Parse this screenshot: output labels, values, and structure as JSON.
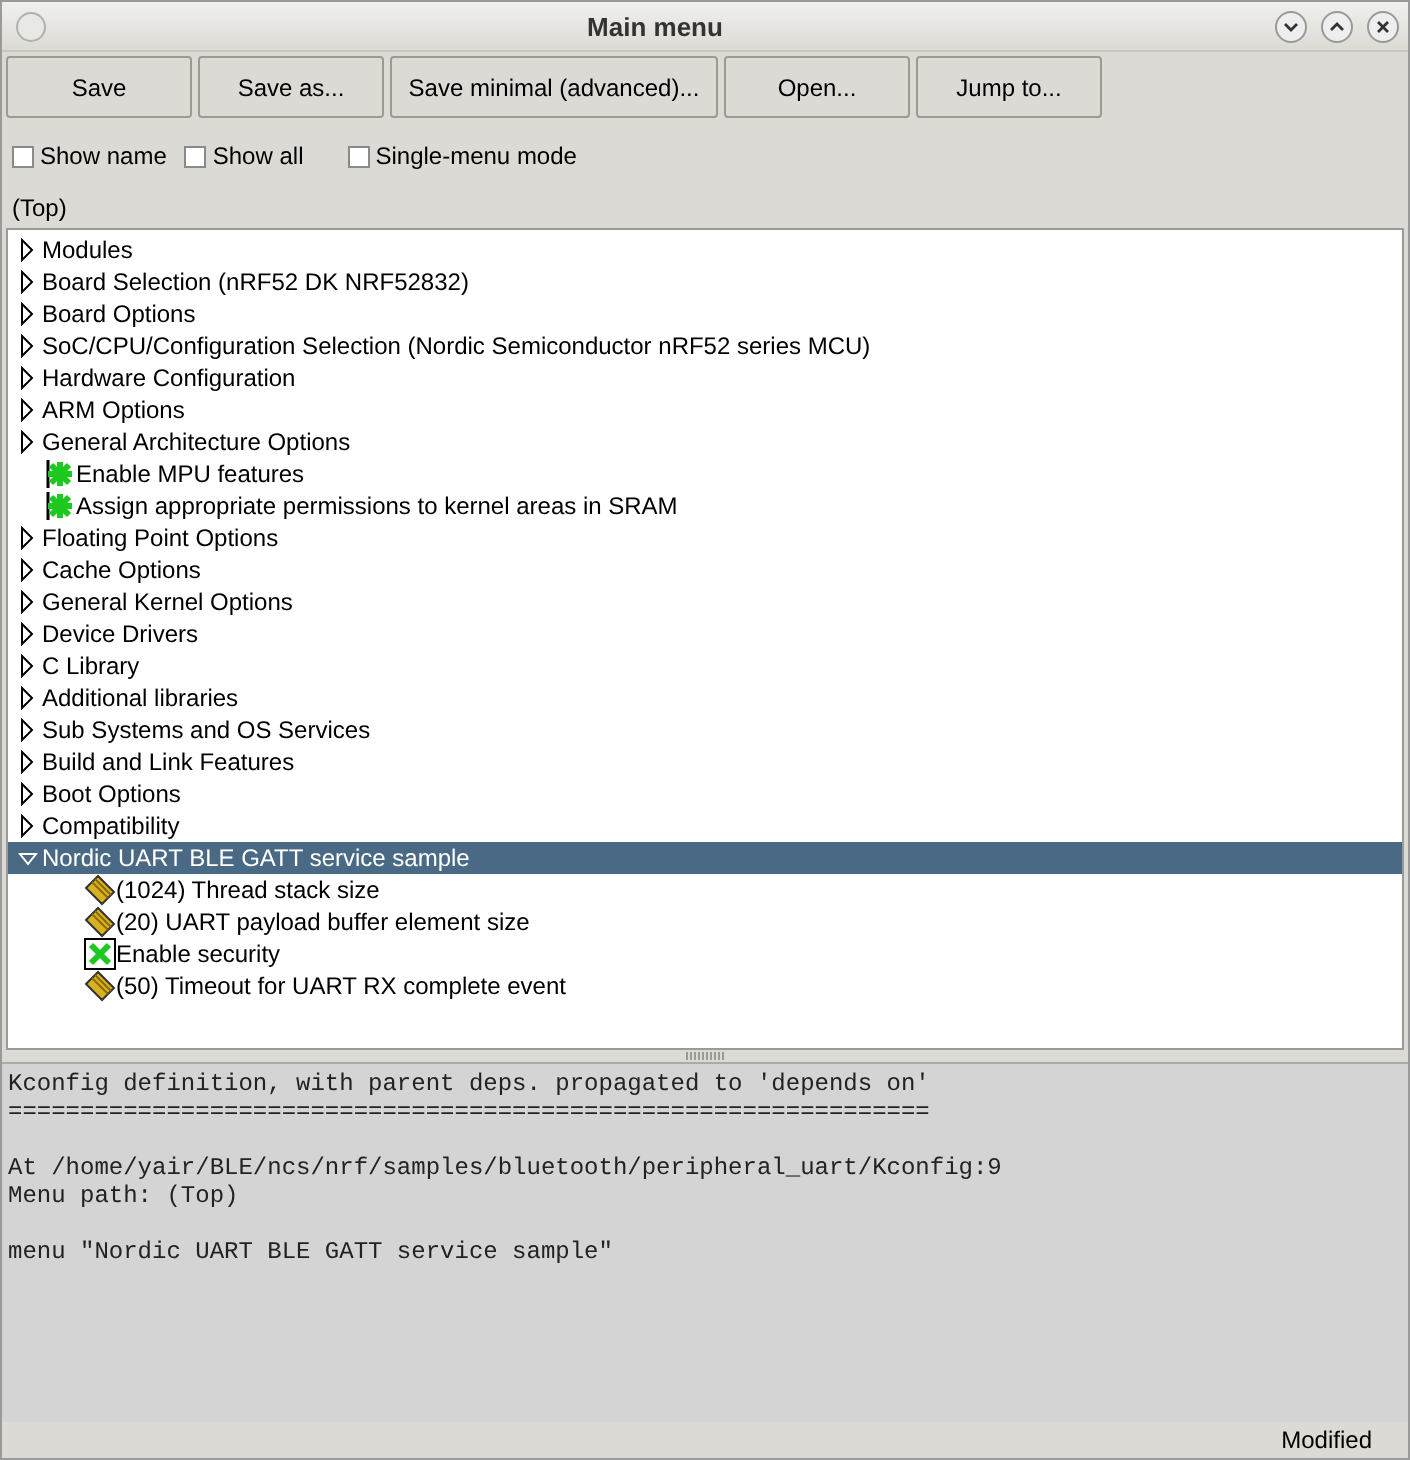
{
  "window": {
    "title": "Main menu"
  },
  "buttons": [
    "Save",
    "Save as...",
    "Save minimal (advanced)...",
    "Open...",
    "Jump to..."
  ],
  "options": [
    {
      "label": "Show name",
      "checked": false
    },
    {
      "label": "Show all",
      "checked": false
    },
    {
      "label": "Single-menu mode",
      "checked": false
    }
  ],
  "menu_path": "(Top)",
  "tree": [
    {
      "kind": "menu",
      "label": "Modules",
      "expanded": false,
      "selected": false
    },
    {
      "kind": "menu",
      "label": "Board Selection (nRF52 DK NRF52832)",
      "expanded": false,
      "selected": false
    },
    {
      "kind": "menu",
      "label": "Board Options",
      "expanded": false,
      "selected": false
    },
    {
      "kind": "menu",
      "label": "SoC/CPU/Configuration Selection (Nordic Semiconductor nRF52 series MCU)",
      "expanded": false,
      "selected": false
    },
    {
      "kind": "menu",
      "label": "Hardware Configuration",
      "expanded": false,
      "selected": false
    },
    {
      "kind": "menu",
      "label": "ARM Options",
      "expanded": false,
      "selected": false
    },
    {
      "kind": "menu",
      "label": "General Architecture Options",
      "expanded": false,
      "selected": false
    },
    {
      "kind": "star",
      "label": "Enable MPU features",
      "selected": false
    },
    {
      "kind": "star",
      "label": "Assign appropriate permissions to kernel areas in SRAM",
      "selected": false
    },
    {
      "kind": "menu",
      "label": "Floating Point Options",
      "expanded": false,
      "selected": false
    },
    {
      "kind": "menu",
      "label": "Cache Options",
      "expanded": false,
      "selected": false
    },
    {
      "kind": "menu",
      "label": "General Kernel Options",
      "expanded": false,
      "selected": false
    },
    {
      "kind": "menu",
      "label": "Device Drivers",
      "expanded": false,
      "selected": false
    },
    {
      "kind": "menu",
      "label": "C Library",
      "expanded": false,
      "selected": false
    },
    {
      "kind": "menu",
      "label": "Additional libraries",
      "expanded": false,
      "selected": false
    },
    {
      "kind": "menu",
      "label": "Sub Systems and OS Services",
      "expanded": false,
      "selected": false
    },
    {
      "kind": "menu",
      "label": "Build and Link Features",
      "expanded": false,
      "selected": false
    },
    {
      "kind": "menu",
      "label": "Boot Options",
      "expanded": false,
      "selected": false
    },
    {
      "kind": "menu",
      "label": "Compatibility",
      "expanded": false,
      "selected": false
    },
    {
      "kind": "menu",
      "label": "Nordic UART BLE GATT service sample",
      "expanded": true,
      "selected": true,
      "children": [
        {
          "kind": "value",
          "label": "(1024) Thread stack size",
          "selected": false
        },
        {
          "kind": "value",
          "label": "(20) UART payload buffer element size",
          "selected": false
        },
        {
          "kind": "checkbox",
          "label": "Enable security",
          "checked": true,
          "selected": false
        },
        {
          "kind": "value",
          "label": "(50) Timeout for UART RX complete event",
          "selected": false
        }
      ]
    }
  ],
  "details": [
    [
      "Kconfig definition, with parent deps. propagated to 'depends on'",
      "================================================================"
    ],
    [
      "At /home/yair/BLE/ncs/nrf/samples/bluetooth/peripheral_uart/Kconfig:9",
      "Menu path: (Top)"
    ],
    [
      "menu \"Nordic UART BLE GATT service sample\""
    ]
  ],
  "status_bar": "Modified"
}
